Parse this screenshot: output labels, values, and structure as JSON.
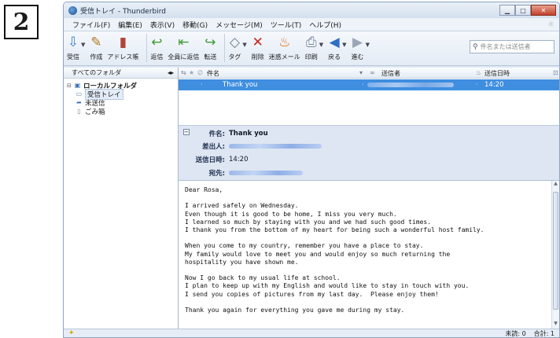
{
  "step": {
    "number": "2"
  },
  "window": {
    "title": "受信トレイ - Thunderbird"
  },
  "menu": [
    "ファイル(F)",
    "編集(E)",
    "表示(V)",
    "移動(G)",
    "メッセージ(M)",
    "ツール(T)",
    "ヘルプ(H)"
  ],
  "toolbar": {
    "get_mail": "受信",
    "write": "作成",
    "address_book": "アドレス帳",
    "reply": "返信",
    "reply_all": "全員に返信",
    "forward": "転送",
    "tag": "タグ",
    "delete": "削除",
    "junk": "迷惑メール",
    "print": "印刷",
    "back": "戻る",
    "next": "進む",
    "search_placeholder": "件名または送信者"
  },
  "folder_pane": {
    "header": "すべてのフォルダ",
    "root": "ローカルフォルダ",
    "items": [
      "受信トレイ",
      "未送信",
      "ごみ箱"
    ]
  },
  "thread_columns": {
    "subject": "件名",
    "sender": "送信者",
    "date": "送信日時"
  },
  "message_list": [
    {
      "subject": "Thank you",
      "date": "14:20",
      "selected": true
    }
  ],
  "message_header": {
    "subject_label": "件名:",
    "subject": "Thank you",
    "from_label": "差出人:",
    "date_label": "送信日時:",
    "date": "14:20",
    "to_label": "宛先:"
  },
  "message_body": "Dear Rosa,\n\nI arrived safely on Wednesday.\nEven though it is good to be home, I miss you very much.\nI learned so much by staying with you and we had such good times.\nI thank you from the bottom of my heart for being such a wonderful host family.\n\nWhen you come to my country, remember you have a place to stay.\nMy family would love to meet you and would enjoy so much returning the\nhospitality you have shown me.\n\nNow I go back to my usual life at school.\nI plan to keep up with my English and would like to stay in touch with you.\nI send you copies of pictures from my last day.  Please enjoy them!\n\nThank you again for everything you gave me during my stay.",
  "status": {
    "unread": "未読: 0",
    "total": "合計: 1"
  },
  "colors": {
    "selection": "#3f8ee0",
    "header_bg": "#dde6f2",
    "window_frame": "#dfe8f3"
  }
}
